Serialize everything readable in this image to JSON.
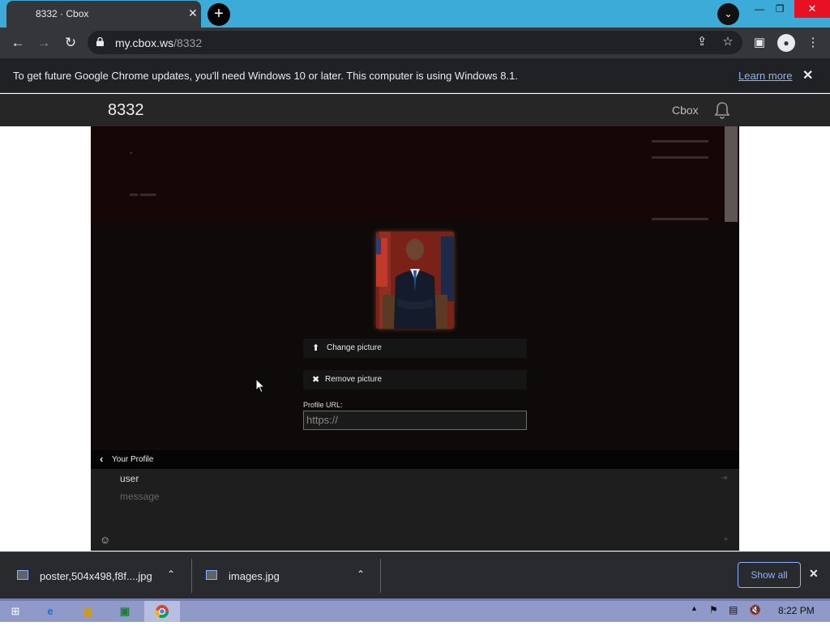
{
  "browser": {
    "tab_title": "8332 · Cbox",
    "url_host": "my.cbox.ws",
    "url_path": "/8332",
    "info_message": "To get future Google Chrome updates, you'll need Windows 10 or later. This computer is using Windows 8.1.",
    "learn_more": "Learn more"
  },
  "page": {
    "title": "8332",
    "brand": "Cbox"
  },
  "profile": {
    "change_picture": "Change picture",
    "remove_picture": "Remove picture",
    "url_label": "Profile URL:",
    "url_placeholder": "https://",
    "back_label": "Your Profile"
  },
  "composer": {
    "user_label": "user",
    "message_placeholder": "message"
  },
  "downloads": {
    "items": [
      {
        "name": "poster,504x498,f8f....jpg"
      },
      {
        "name": "images.jpg"
      }
    ],
    "show_all": "Show all"
  },
  "taskbar": {
    "clock": "8:22 PM"
  },
  "icons": {
    "tab_close": "close-icon",
    "new_tab": "plus-icon",
    "back": "arrow-left-icon",
    "forward": "arrow-right-icon",
    "reload": "reload-icon",
    "lock": "lock-icon",
    "share": "share-icon",
    "star": "star-icon",
    "sidepanel": "side-panel-icon",
    "profile": "profile-icon",
    "menu": "kebab-menu-icon",
    "bell": "bell-icon",
    "upload": "upload-icon",
    "remove": "x-icon",
    "smile": "smiley-icon"
  },
  "colors": {
    "tab_strip": "#3cabd8",
    "toolbar": "#35363a",
    "panel_bg": "#0f0a0a",
    "link": "#8ab4f8",
    "close_red": "#e81123"
  }
}
